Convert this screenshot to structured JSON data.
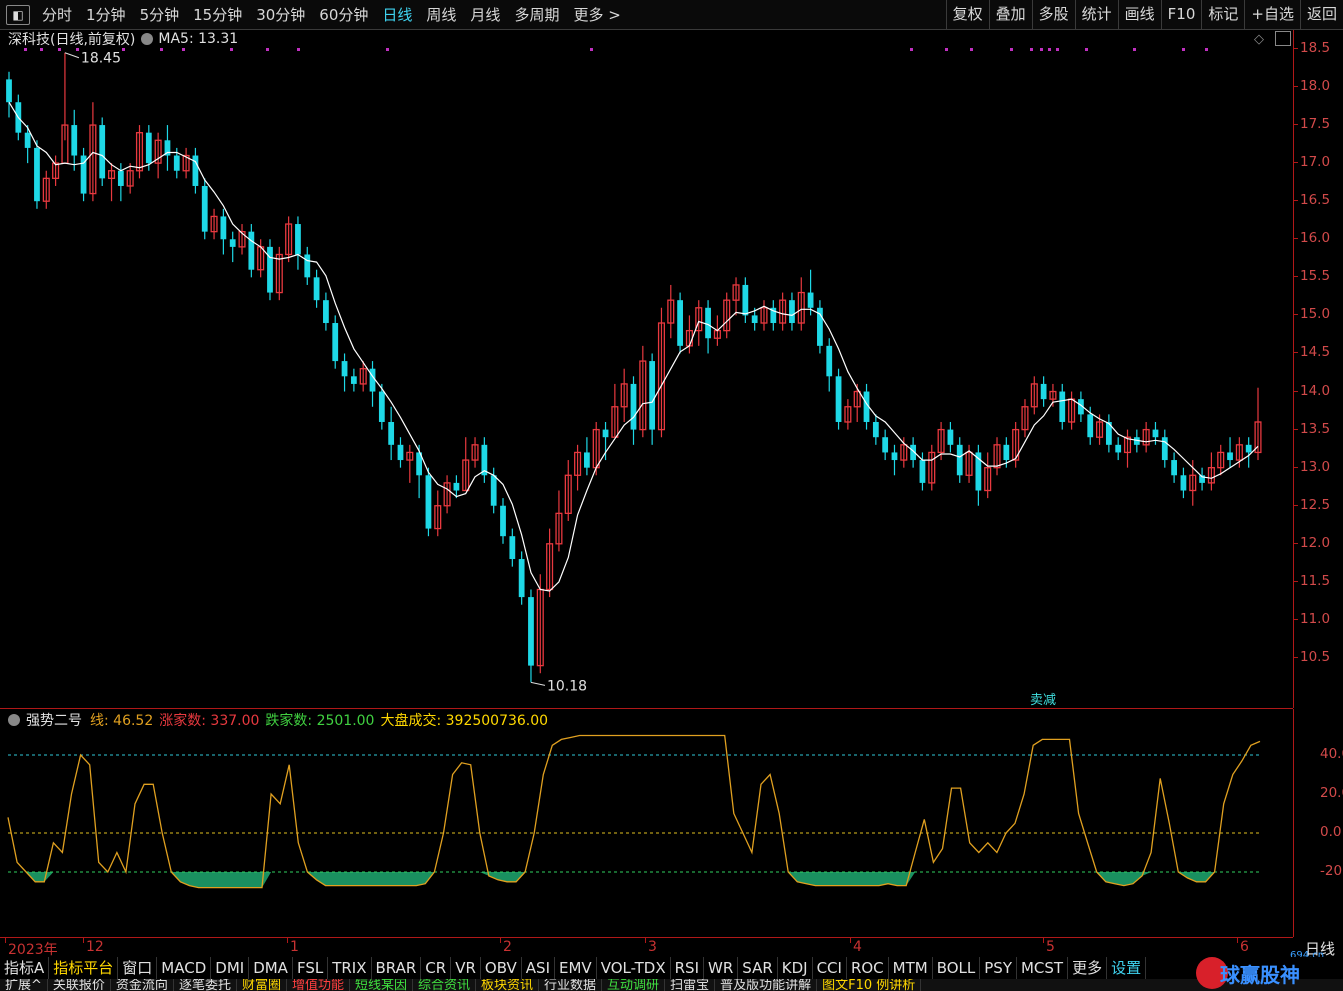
{
  "toolbar": {
    "periods": [
      "分时",
      "1分钟",
      "5分钟",
      "15分钟",
      "30分钟",
      "60分钟",
      "日线",
      "周线",
      "月线",
      "多周期",
      "更多 >"
    ],
    "active_period": "日线",
    "tools": [
      "复权",
      "叠加",
      "多股",
      "统计",
      "画线",
      "F10",
      "标记",
      "+自选",
      "返回"
    ]
  },
  "chart_header": {
    "stock": "深科技(日线,前复权)",
    "ma_label": "MA5: 13.31"
  },
  "annotations": {
    "high": "18.45",
    "low": "10.18",
    "sell_marker": "卖减"
  },
  "price_axis_ticks": [
    "18.5",
    "18.0",
    "17.5",
    "17.0",
    "16.5",
    "16.0",
    "15.5",
    "15.0",
    "14.5",
    "14.0",
    "13.5",
    "13.0",
    "12.5",
    "12.0",
    "11.5",
    "11.0",
    "10.5"
  ],
  "indicator": {
    "name": "强势二号",
    "line_label": "线: 46.52",
    "up_label": "涨家数: 337.00",
    "down_label": "跌家数: 2501.00",
    "volume_label": "大盘成交: 392500736.00",
    "axis_ticks": [
      "40.0",
      "20.0",
      "0.0",
      "-20.0"
    ]
  },
  "date_axis": [
    "2023年",
    "12",
    "1",
    "2",
    "3",
    "4",
    "5",
    "6"
  ],
  "period_label": "日线",
  "indicator_tabs": [
    "指标A",
    "指标平台",
    "窗口",
    "MACD",
    "DMI",
    "DMA",
    "FSL",
    "TRIX",
    "BRAR",
    "CR",
    "VR",
    "OBV",
    "ASI",
    "EMV",
    "VOL-TDX",
    "RSI",
    "WR",
    "SAR",
    "KDJ",
    "CCI",
    "ROC",
    "MTM",
    "BOLL",
    "PSY",
    "MCST",
    "更多",
    "设置"
  ],
  "function_tabs": [
    "扩展^",
    "关联报价",
    "资金流向",
    "逐笔委托",
    "财富圈",
    "增值功能",
    "短线某因",
    "综合资讯",
    "板块资讯",
    "行业数据",
    "互动调研",
    "扫雷宝",
    "普及版功能讲解",
    "图文F10 例讲析"
  ],
  "watermarks": {
    "site": "694.cn",
    "logo_text": "球赢股神"
  },
  "colors": {
    "up": "#e8393f",
    "down": "#1ed8e6",
    "ma": "#ffffff",
    "indicator_line": "#e0a020",
    "fill_green": "#1a9060",
    "axis": "#b01818"
  },
  "chart_data": {
    "type": "candlestick",
    "title": "深科技(日线,前复权)",
    "ylim": [
      10.1,
      18.6
    ],
    "candles": [
      [
        18.1,
        17.8,
        18.2,
        17.6
      ],
      [
        17.8,
        17.4,
        17.9,
        17.3
      ],
      [
        17.4,
        17.2,
        17.5,
        17.0
      ],
      [
        17.2,
        16.5,
        17.3,
        16.4
      ],
      [
        16.5,
        16.8,
        16.9,
        16.4
      ],
      [
        16.8,
        17.0,
        17.1,
        16.7
      ],
      [
        17.0,
        17.5,
        18.45,
        17.3
      ],
      [
        17.5,
        17.1,
        17.7,
        16.9
      ],
      [
        17.1,
        16.6,
        17.2,
        16.5
      ],
      [
        16.6,
        17.5,
        17.8,
        16.5
      ],
      [
        17.5,
        16.8,
        17.6,
        16.7
      ],
      [
        16.8,
        16.9,
        17.0,
        16.5
      ],
      [
        16.9,
        16.7,
        17.0,
        16.5
      ],
      [
        16.7,
        16.9,
        17.0,
        16.6
      ],
      [
        16.9,
        17.4,
        17.5,
        16.8
      ],
      [
        17.4,
        17.0,
        17.5,
        16.9
      ],
      [
        17.0,
        17.3,
        17.4,
        16.8
      ],
      [
        17.3,
        17.1,
        17.5,
        16.9
      ],
      [
        17.1,
        16.9,
        17.2,
        16.8
      ],
      [
        16.9,
        17.1,
        17.2,
        16.8
      ],
      [
        17.1,
        16.7,
        17.2,
        16.6
      ],
      [
        16.7,
        16.1,
        16.8,
        16.0
      ],
      [
        16.1,
        16.3,
        16.4,
        16.0
      ],
      [
        16.3,
        16.0,
        16.4,
        15.8
      ],
      [
        16.0,
        15.9,
        16.1,
        15.7
      ],
      [
        15.9,
        16.1,
        16.2,
        15.8
      ],
      [
        16.1,
        15.6,
        16.2,
        15.5
      ],
      [
        15.6,
        15.9,
        16.0,
        15.5
      ],
      [
        15.9,
        15.3,
        16.0,
        15.2
      ],
      [
        15.3,
        15.8,
        15.9,
        15.2
      ],
      [
        15.8,
        16.2,
        16.3,
        15.7
      ],
      [
        16.2,
        15.8,
        16.3,
        15.6
      ],
      [
        15.8,
        15.5,
        15.9,
        15.4
      ],
      [
        15.5,
        15.2,
        15.6,
        15.1
      ],
      [
        15.2,
        14.9,
        15.3,
        14.8
      ],
      [
        14.9,
        14.4,
        15.0,
        14.3
      ],
      [
        14.4,
        14.2,
        14.5,
        14.0
      ],
      [
        14.2,
        14.1,
        14.3,
        14.0
      ],
      [
        14.1,
        14.3,
        14.4,
        14.0
      ],
      [
        14.3,
        14.0,
        14.4,
        13.8
      ],
      [
        14.0,
        13.6,
        14.1,
        13.5
      ],
      [
        13.6,
        13.3,
        13.8,
        13.1
      ],
      [
        13.3,
        13.1,
        13.4,
        13.0
      ],
      [
        13.1,
        13.2,
        13.3,
        12.8
      ],
      [
        13.2,
        12.9,
        13.3,
        12.6
      ],
      [
        12.9,
        12.2,
        13.0,
        12.1
      ],
      [
        12.2,
        12.5,
        12.7,
        12.1
      ],
      [
        12.5,
        12.8,
        12.9,
        12.4
      ],
      [
        12.8,
        12.7,
        12.9,
        12.6
      ],
      [
        12.7,
        13.1,
        13.4,
        12.7
      ],
      [
        13.1,
        13.3,
        13.4,
        13.0
      ],
      [
        13.3,
        12.9,
        13.4,
        12.8
      ],
      [
        12.9,
        12.5,
        13.0,
        12.4
      ],
      [
        12.5,
        12.1,
        12.6,
        12.0
      ],
      [
        12.1,
        11.8,
        12.2,
        11.7
      ],
      [
        11.8,
        11.3,
        11.9,
        11.2
      ],
      [
        11.3,
        10.4,
        11.4,
        10.18
      ],
      [
        10.4,
        11.4,
        11.6,
        10.3
      ],
      [
        11.4,
        12.0,
        12.2,
        11.3
      ],
      [
        12.0,
        12.4,
        12.7,
        11.9
      ],
      [
        12.4,
        12.9,
        13.1,
        12.3
      ],
      [
        12.9,
        13.2,
        13.3,
        12.7
      ],
      [
        13.2,
        13.0,
        13.4,
        12.9
      ],
      [
        13.0,
        13.5,
        13.6,
        12.9
      ],
      [
        13.5,
        13.4,
        13.6,
        13.1
      ],
      [
        13.4,
        13.8,
        14.1,
        13.4
      ],
      [
        13.8,
        14.1,
        14.3,
        13.6
      ],
      [
        14.1,
        13.5,
        14.2,
        13.3
      ],
      [
        13.5,
        14.4,
        14.6,
        13.4
      ],
      [
        14.4,
        13.5,
        14.5,
        13.3
      ],
      [
        13.5,
        14.9,
        15.1,
        13.4
      ],
      [
        14.9,
        15.2,
        15.4,
        14.7
      ],
      [
        15.2,
        14.6,
        15.3,
        14.5
      ],
      [
        14.6,
        14.8,
        15.0,
        14.5
      ],
      [
        14.8,
        15.1,
        15.2,
        14.6
      ],
      [
        15.1,
        14.7,
        15.2,
        14.5
      ],
      [
        14.7,
        14.8,
        15.0,
        14.6
      ],
      [
        14.8,
        15.2,
        15.3,
        14.7
      ],
      [
        15.2,
        15.4,
        15.5,
        15.0
      ],
      [
        15.4,
        15.0,
        15.5,
        14.9
      ],
      [
        15.0,
        14.9,
        15.1,
        14.8
      ],
      [
        14.9,
        15.1,
        15.2,
        14.8
      ],
      [
        15.1,
        14.9,
        15.2,
        14.8
      ],
      [
        14.9,
        15.2,
        15.3,
        14.8
      ],
      [
        15.2,
        14.9,
        15.3,
        14.8
      ],
      [
        14.9,
        15.3,
        15.5,
        14.8
      ],
      [
        15.3,
        15.1,
        15.6,
        15.0
      ],
      [
        15.1,
        14.6,
        15.2,
        14.5
      ],
      [
        14.6,
        14.2,
        14.7,
        14.0
      ],
      [
        14.2,
        13.6,
        14.3,
        13.5
      ],
      [
        13.6,
        13.8,
        13.9,
        13.5
      ],
      [
        13.8,
        14.0,
        14.1,
        13.6
      ],
      [
        14.0,
        13.6,
        14.1,
        13.5
      ],
      [
        13.6,
        13.4,
        13.7,
        13.3
      ],
      [
        13.4,
        13.2,
        13.5,
        13.1
      ],
      [
        13.2,
        13.1,
        13.3,
        12.9
      ],
      [
        13.1,
        13.3,
        13.4,
        13.0
      ],
      [
        13.3,
        13.1,
        13.4,
        13.0
      ],
      [
        13.1,
        12.8,
        13.2,
        12.7
      ],
      [
        12.8,
        13.2,
        13.3,
        12.7
      ],
      [
        13.2,
        13.5,
        13.6,
        13.1
      ],
      [
        13.5,
        13.3,
        13.6,
        13.2
      ],
      [
        13.3,
        12.9,
        13.4,
        12.8
      ],
      [
        12.9,
        13.2,
        13.3,
        12.8
      ],
      [
        13.2,
        12.7,
        13.3,
        12.5
      ],
      [
        12.7,
        13.0,
        13.2,
        12.6
      ],
      [
        13.0,
        13.3,
        13.4,
        12.9
      ],
      [
        13.3,
        13.1,
        13.4,
        13.0
      ],
      [
        13.1,
        13.5,
        13.6,
        13.0
      ],
      [
        13.5,
        13.8,
        13.9,
        13.4
      ],
      [
        13.8,
        14.1,
        14.2,
        13.7
      ],
      [
        14.1,
        13.9,
        14.2,
        13.8
      ],
      [
        13.9,
        14.0,
        14.1,
        13.8
      ],
      [
        14.0,
        13.6,
        14.1,
        13.5
      ],
      [
        13.6,
        13.9,
        14.0,
        13.5
      ],
      [
        13.9,
        13.7,
        14.0,
        13.6
      ],
      [
        13.7,
        13.4,
        13.8,
        13.3
      ],
      [
        13.4,
        13.6,
        13.7,
        13.3
      ],
      [
        13.6,
        13.3,
        13.7,
        13.2
      ],
      [
        13.3,
        13.2,
        13.4,
        13.1
      ],
      [
        13.2,
        13.4,
        13.5,
        13.0
      ],
      [
        13.4,
        13.3,
        13.5,
        13.2
      ],
      [
        13.3,
        13.5,
        13.6,
        13.2
      ],
      [
        13.5,
        13.4,
        13.6,
        13.3
      ],
      [
        13.4,
        13.1,
        13.5,
        13.0
      ],
      [
        13.1,
        12.9,
        13.2,
        12.8
      ],
      [
        12.9,
        12.7,
        13.0,
        12.6
      ],
      [
        12.7,
        12.9,
        13.1,
        12.5
      ],
      [
        12.9,
        12.8,
        13.0,
        12.7
      ],
      [
        12.8,
        13.0,
        13.2,
        12.7
      ],
      [
        13.0,
        13.2,
        13.3,
        12.9
      ],
      [
        13.2,
        13.1,
        13.4,
        13.0
      ],
      [
        13.1,
        13.3,
        13.4,
        13.0
      ],
      [
        13.3,
        13.2,
        13.4,
        13.0
      ],
      [
        13.2,
        13.6,
        14.05,
        13.1
      ]
    ],
    "indicator_line": [
      8,
      -15,
      -20,
      -25,
      -25,
      -5,
      -10,
      20,
      40,
      35,
      -15,
      -20,
      -10,
      -20,
      15,
      25,
      25,
      0,
      -20,
      -25,
      -27,
      -28,
      -28,
      -28,
      -28,
      -28,
      -28,
      -28,
      -28,
      20,
      15,
      35,
      -5,
      -20,
      -24,
      -27,
      -27,
      -27,
      -27,
      -27,
      -27,
      -27,
      -27,
      -27,
      -27,
      -27,
      -26,
      -20,
      0,
      30,
      36,
      35,
      0,
      -22,
      -24,
      -25,
      -25,
      -20,
      0,
      30,
      45,
      48,
      49,
      50,
      50,
      50,
      50,
      50,
      50,
      50,
      50,
      50,
      50,
      50,
      50,
      50,
      50,
      50,
      50,
      50,
      10,
      0,
      -10,
      25,
      30,
      10,
      -20,
      -25,
      -26,
      -27,
      -27,
      -27,
      -27,
      -27,
      -27,
      -27,
      -27,
      -26,
      -27,
      -27,
      -10,
      7,
      -15,
      -8,
      23,
      23,
      -5,
      -10,
      -5,
      -10,
      0,
      5,
      20,
      45,
      48,
      48,
      48,
      48,
      10,
      -5,
      -20,
      -25,
      -26,
      -27,
      -26,
      -22,
      -10,
      28,
      5,
      -20,
      -23,
      -25,
      -25,
      -20,
      15,
      30,
      37,
      45,
      47
    ]
  }
}
